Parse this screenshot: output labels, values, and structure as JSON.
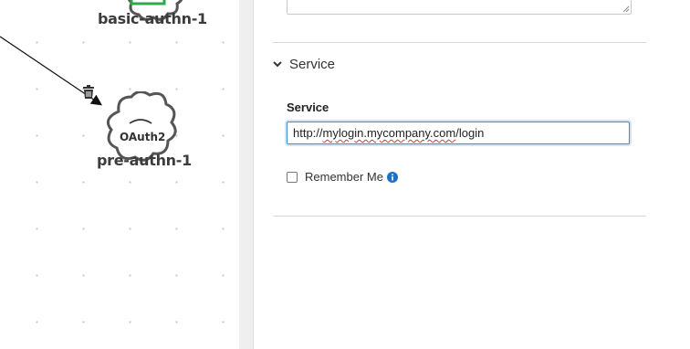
{
  "canvas": {
    "nodes": [
      {
        "label": "basic-authn-1",
        "badge_color": "#2ea84a"
      },
      {
        "label": "pre-authn-1",
        "glyph": "OAuth2"
      }
    ],
    "icons": [
      "trash-icon",
      "arrow-edge"
    ]
  },
  "panel": {
    "section": {
      "title": "Service",
      "expanded": true,
      "icon": "chevron-down-icon"
    },
    "service_field": {
      "label": "Service",
      "value_parts": [
        "http://",
        "mylogin.mycompany.com",
        "/login"
      ]
    },
    "remember_me": {
      "label": "Remember Me",
      "checked": false,
      "icon": "info-icon"
    }
  },
  "colors": {
    "focus_border": "#3e8fcf",
    "info_icon": "#1a73c8",
    "badge": "#2ea84a"
  }
}
